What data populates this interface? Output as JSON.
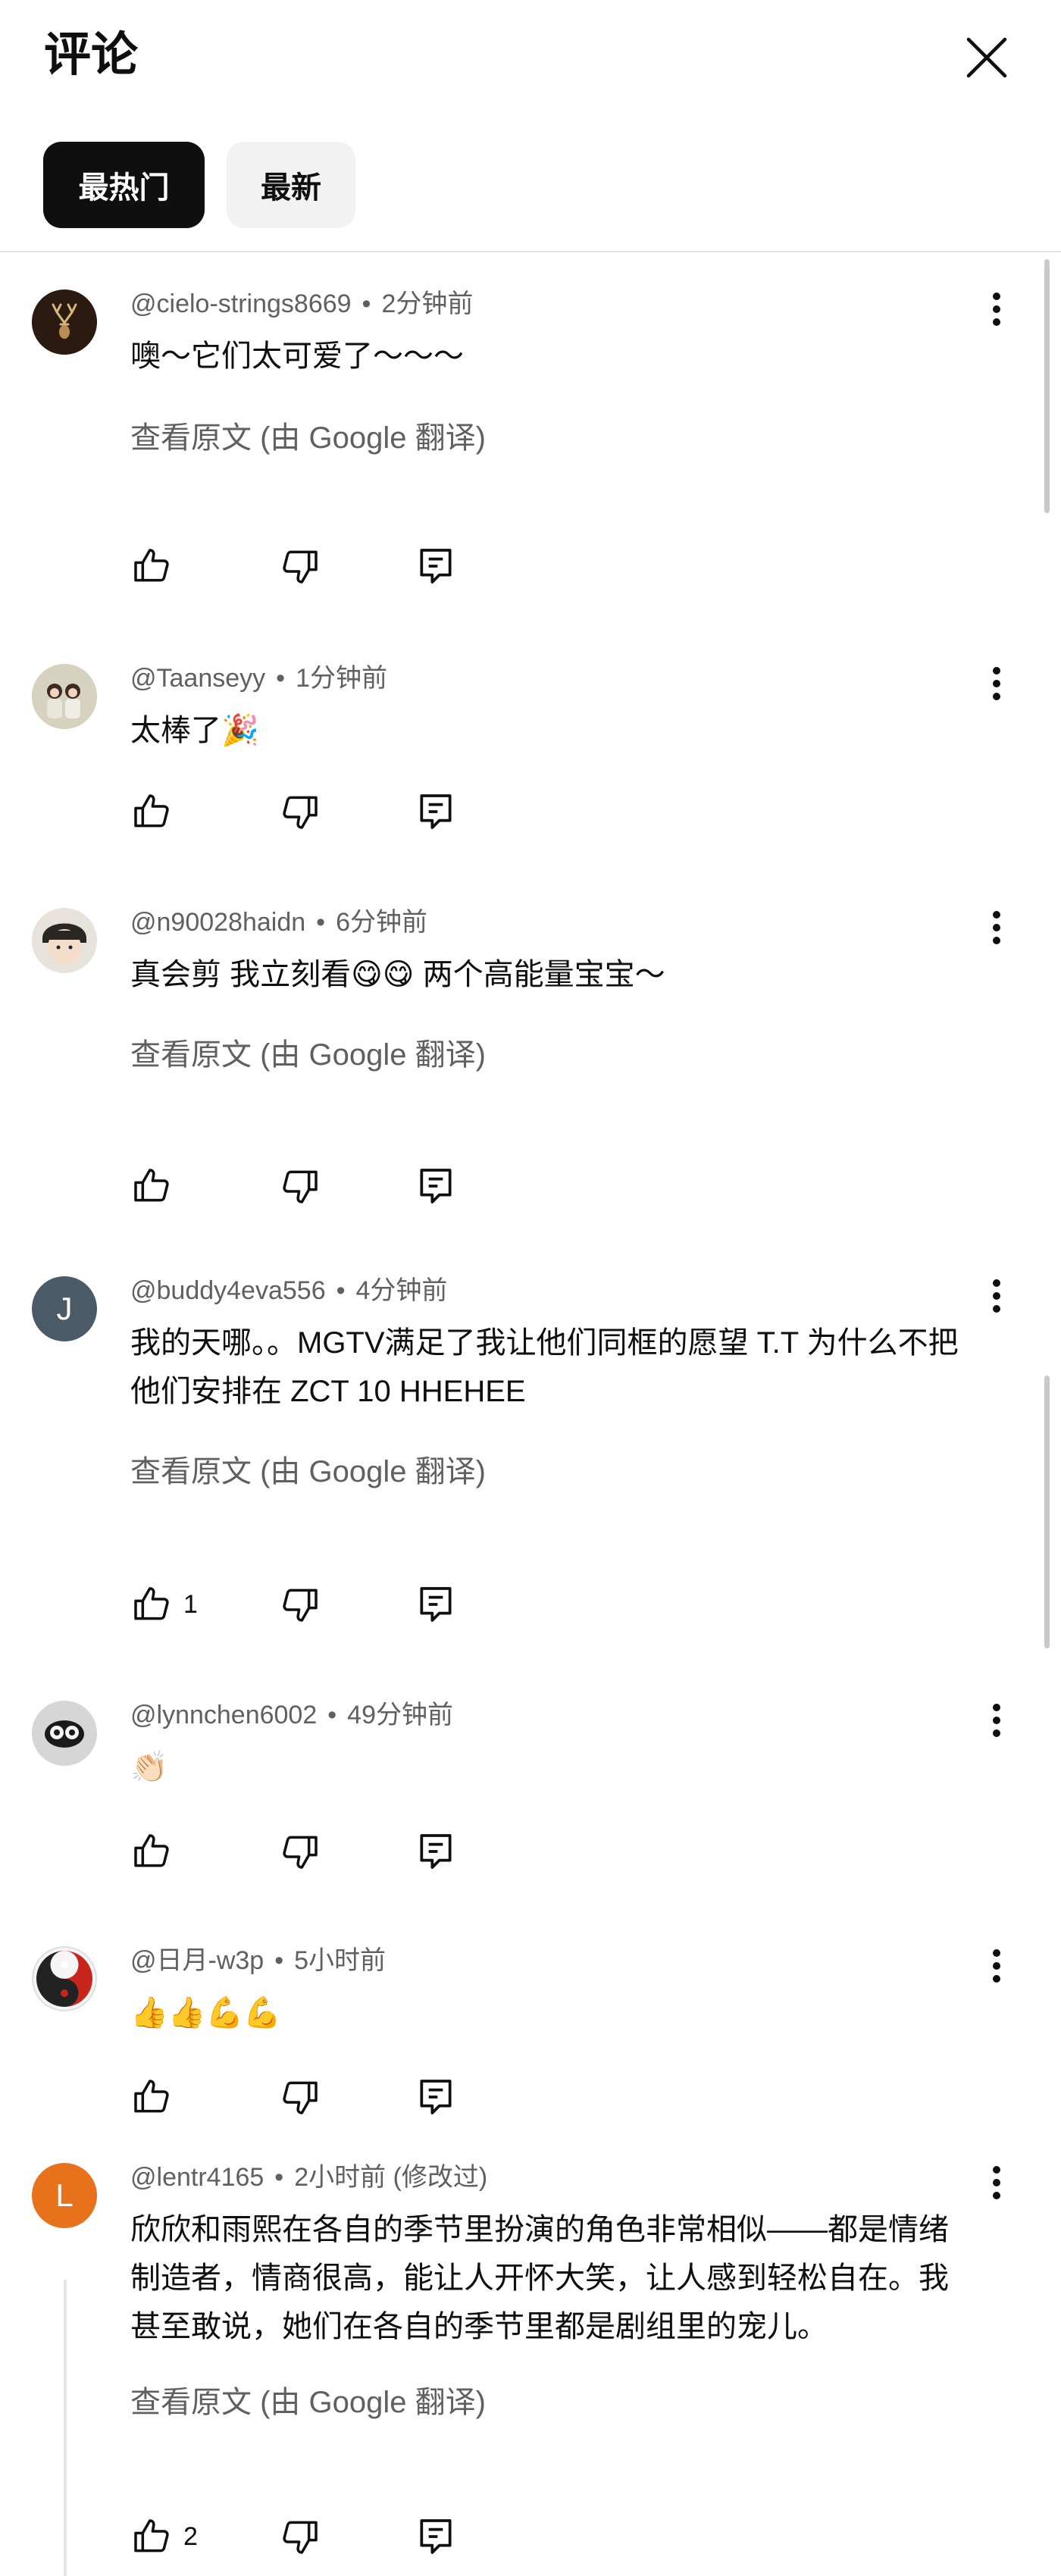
{
  "header": {
    "title": "评论"
  },
  "tabs": [
    {
      "label": "最热门",
      "active": true
    },
    {
      "label": "最新",
      "active": false
    }
  ],
  "translate_label": "查看原文 (由 Google 翻译)",
  "comments": [
    {
      "author": "@cielo-strings8669",
      "time": "2分钟前",
      "text": "噢～它们太可爱了～～～",
      "likes": "",
      "translated": true
    },
    {
      "author": "@Taanseyy",
      "time": "1分钟前",
      "text": "太棒了🎉",
      "likes": "",
      "translated": false
    },
    {
      "author": "@n90028haidn",
      "time": "6分钟前",
      "text": "真会剪 我立刻看😋😋 两个高能量宝宝～",
      "likes": "",
      "translated": true
    },
    {
      "author": "@buddy4eva556",
      "time": "4分钟前",
      "text": "我的天哪。。MGTV满足了我让他们同框的愿望 T.T 为什么不把他们安排在 ZCT 10 HHEHEE",
      "likes": "1",
      "translated": true,
      "avatar_letter": "J"
    },
    {
      "author": "@lynnchen6002",
      "time": "49分钟前",
      "text": "👏🏻",
      "likes": "",
      "translated": false
    },
    {
      "author": "@日月-w3p",
      "time": "5小时前",
      "text": "👍👍💪💪",
      "likes": "",
      "translated": false
    },
    {
      "author": "@lentr4165",
      "time": "2小时前 (修改过)",
      "text": "欣欣和雨熙在各自的季节里扮演的角色非常相似——都是情绪制造者，情商很高，能让人开怀大笑，让人感到轻松自在。我甚至敢说，她们在各自的季节里都是剧组里的宠儿。",
      "likes": "2",
      "translated": true,
      "avatar_letter": "L"
    }
  ],
  "colors": {
    "accent_dark": "#0f0f0f",
    "chip_idle": "#f2f2f2",
    "muted_text": "#606060",
    "avatar_j": "#4a5a66",
    "avatar_l": "#e8711c"
  }
}
